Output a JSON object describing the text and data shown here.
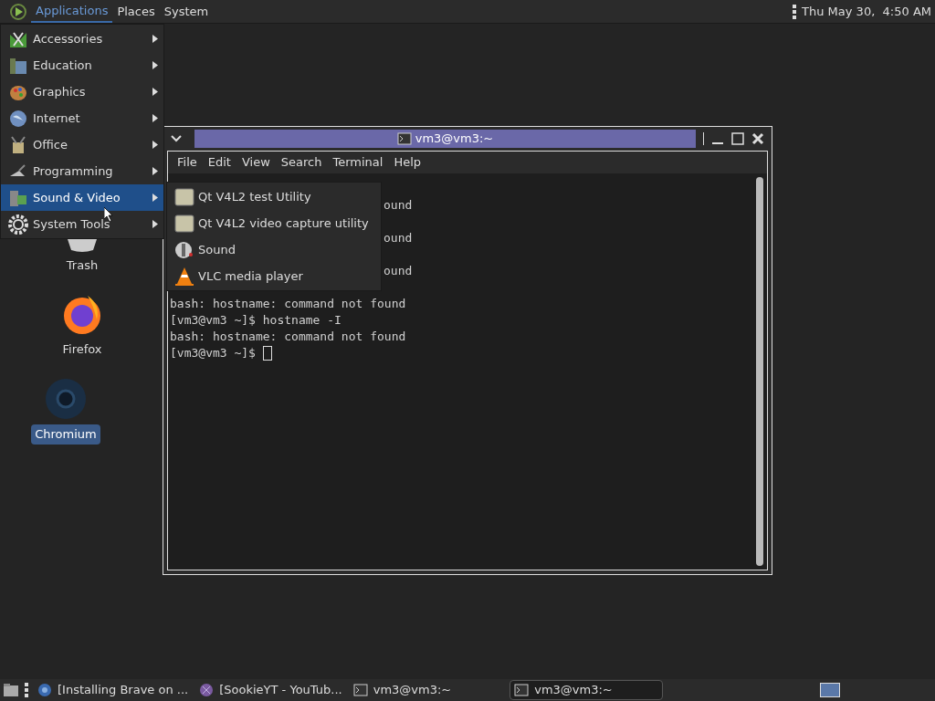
{
  "top_panel": {
    "menus": [
      {
        "label": "Applications",
        "selected": true
      },
      {
        "label": "Places",
        "selected": false
      },
      {
        "label": "System",
        "selected": false
      }
    ],
    "clock": "Thu May 30,  4:50 AM"
  },
  "desktop_icons": [
    {
      "label": "Trash",
      "kind": "trash",
      "selected": false
    },
    {
      "label": "Firefox",
      "kind": "firefox",
      "selected": false
    },
    {
      "label": "Chromium",
      "kind": "chromium",
      "selected": true
    }
  ],
  "terminal": {
    "title": "vm3@vm3:~",
    "menu": [
      "File",
      "Edit",
      "View",
      "Search",
      "Terminal",
      "Help"
    ],
    "lines": [
      {
        "kind": "blank"
      },
      {
        "kind": "tail",
        "text": "ound"
      },
      {
        "kind": "blank"
      },
      {
        "kind": "tail",
        "text": "ound"
      },
      {
        "kind": "blank"
      },
      {
        "kind": "tail",
        "text": "ound"
      },
      {
        "kind": "blank"
      },
      {
        "kind": "full",
        "text": "bash: hostname: command not found"
      },
      {
        "kind": "full",
        "text": "[vm3@vm3 ~]$ hostname -I"
      },
      {
        "kind": "full",
        "text": "bash: hostname: command not found"
      },
      {
        "kind": "prompt",
        "text": "[vm3@vm3 ~]$ "
      }
    ]
  },
  "applications_menu": [
    {
      "label": "Accessories",
      "selected": false
    },
    {
      "label": "Education",
      "selected": false
    },
    {
      "label": "Graphics",
      "selected": false
    },
    {
      "label": "Internet",
      "selected": false
    },
    {
      "label": "Office",
      "selected": false
    },
    {
      "label": "Programming",
      "selected": false
    },
    {
      "label": "Sound & Video",
      "selected": true
    },
    {
      "label": "System Tools",
      "selected": false
    }
  ],
  "submenu": [
    {
      "label": "Qt V4L2 test Utility",
      "kind": "app"
    },
    {
      "label": "Qt V4L2 video capture utility",
      "kind": "app"
    },
    {
      "label": "Sound",
      "kind": "sound"
    },
    {
      "label": "VLC media player",
      "kind": "cone"
    }
  ],
  "taskbar": {
    "tasks": [
      {
        "label": "[Installing Brave on ...",
        "kind": "globe",
        "selected": false
      },
      {
        "label": "[SookieYT - YouTub...",
        "kind": "browser",
        "selected": false
      },
      {
        "label": "vm3@vm3:~",
        "kind": "terminal",
        "selected": false
      },
      {
        "label": "vm3@vm3:~",
        "kind": "terminal",
        "selected": true
      }
    ]
  }
}
